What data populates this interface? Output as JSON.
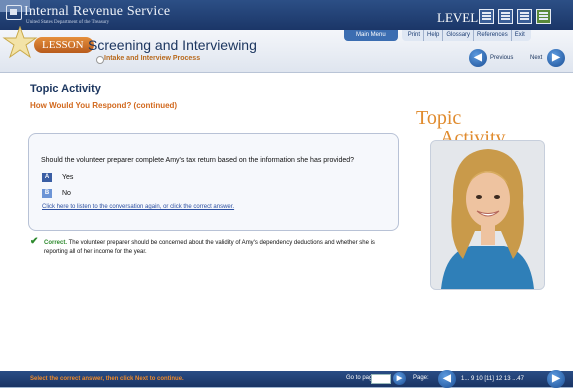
{
  "header": {
    "org_title": "Internal Revenue Service",
    "org_subtitle": "United States Department of the Treasury",
    "level_label": "LEVEL:",
    "level_icons": [
      "level-1-icon",
      "level-2-icon",
      "level-3-icon",
      "level-4-icon"
    ]
  },
  "lesson": {
    "tag": "LESSON",
    "title": "Screening and Interviewing",
    "subtitle": "Intake and Interview Process"
  },
  "menu": {
    "main_menu": "Main Menu",
    "links": [
      "Print",
      "Help",
      "Glossary",
      "References",
      "Exit"
    ]
  },
  "nav": {
    "previous": "Previous",
    "next": "Next"
  },
  "content": {
    "heading": "Topic Activity",
    "subheading": "How Would You Respond? (continued)",
    "question": "Should the volunteer preparer complete Amy's tax return based on the information she has provided?",
    "options": [
      {
        "letter": "A",
        "label": "Yes"
      },
      {
        "letter": "B",
        "label": "No"
      }
    ],
    "listen_link": "Click here to listen to the conversation again, or click the correct answer.",
    "correct_label": "Correct.",
    "correct_text": " The volunteer preparer should be concerned about the validity of Amy's dependency deductions and whether she is reporting all of her income for the year."
  },
  "side": {
    "art_line1": "Topic",
    "art_line2": "Activity"
  },
  "footer": {
    "instruction": "Select the correct answer, then click Next to continue.",
    "goto_label": "Go to page",
    "page_label": "Page:",
    "pages": "1... 9 10 [11] 12 13 ...47"
  },
  "colors": {
    "header_blue": "#1b3668",
    "accent_orange": "#d2691e",
    "correct_green": "#2d8a2d"
  }
}
